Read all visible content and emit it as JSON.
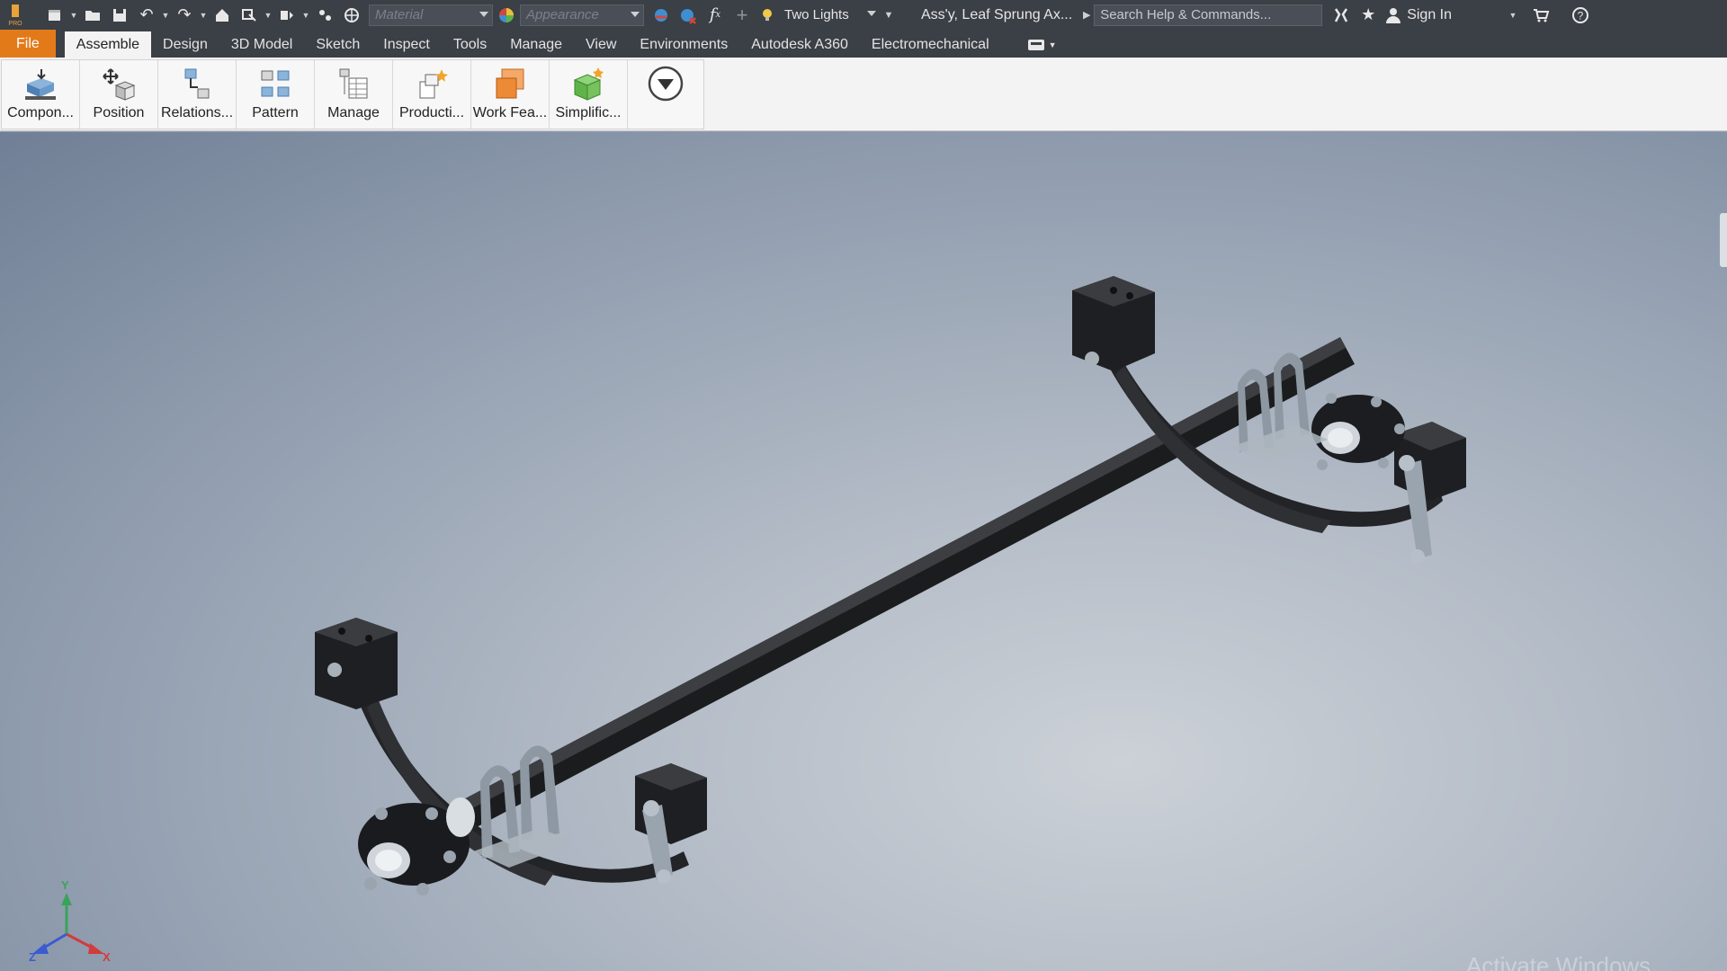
{
  "app": {
    "logo_label": "PRO"
  },
  "quick_access": {
    "material": {
      "placeholder": "Material"
    },
    "appearance": {
      "placeholder": "Appearance"
    },
    "lighting": {
      "value": "Two Lights"
    },
    "document_title": "Ass'y, Leaf Sprung Ax...",
    "search": {
      "placeholder": "Search Help & Commands..."
    },
    "sign_in": "Sign In"
  },
  "tabs": [
    {
      "label": "File"
    },
    {
      "label": "Assemble"
    },
    {
      "label": "Design"
    },
    {
      "label": "3D Model"
    },
    {
      "label": "Sketch"
    },
    {
      "label": "Inspect"
    },
    {
      "label": "Tools"
    },
    {
      "label": "Manage"
    },
    {
      "label": "View"
    },
    {
      "label": "Environments"
    },
    {
      "label": "Autodesk A360"
    },
    {
      "label": "Electromechanical"
    }
  ],
  "ribbon": {
    "buttons": [
      {
        "label": "Compon..."
      },
      {
        "label": "Position"
      },
      {
        "label": "Relations..."
      },
      {
        "label": "Pattern"
      },
      {
        "label": "Manage"
      },
      {
        "label": "Producti..."
      },
      {
        "label": "Work Fea..."
      },
      {
        "label": "Simplific..."
      }
    ]
  },
  "viewcube_triad": {
    "x": "X",
    "y": "Y",
    "z": "Z"
  },
  "watermark": "Activate Windows",
  "colors": {
    "file_tab": "#e37a1a",
    "chrome": "#3b3f46",
    "ribbon": "#f3f3f3",
    "part_dark": "#2a2b2d",
    "bracket": "#9aa4ae"
  }
}
